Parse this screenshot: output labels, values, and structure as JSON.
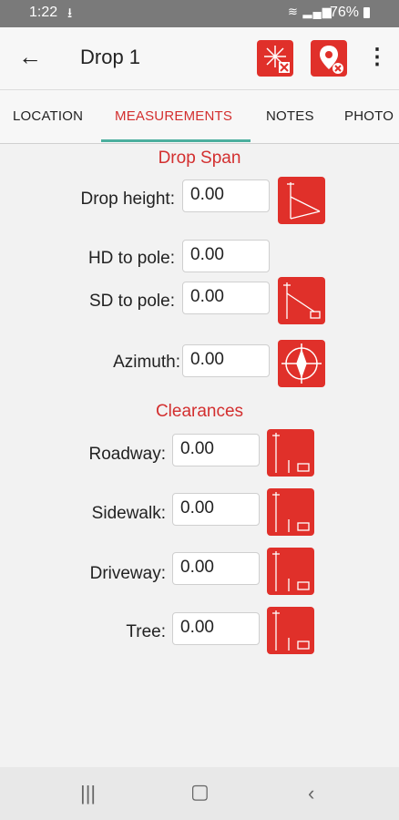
{
  "status": {
    "time": "1:22",
    "download_icon": "download-icon",
    "signal_icon": "wifi-signal-icon",
    "battery": "76%"
  },
  "appbar": {
    "title": "Drop 1",
    "back_icon": "arrow-left-icon",
    "action1_icon": "clear-measurement-icon",
    "action2_icon": "remove-location-icon",
    "more_icon": "more-vertical-icon"
  },
  "tabs": [
    {
      "label": "LOCATION"
    },
    {
      "label": "MEASUREMENTS"
    },
    {
      "label": "NOTES"
    },
    {
      "label": "PHOTO"
    }
  ],
  "active_tab": "MEASUREMENTS",
  "drop_span": {
    "title": "Drop Span",
    "drop_height": {
      "label": "Drop height:",
      "value": "0.00"
    },
    "hd_to_pole": {
      "label": "HD to pole:",
      "value": "0.00"
    },
    "sd_to_pole": {
      "label": "SD to pole:",
      "value": "0.00"
    },
    "azimuth": {
      "label": "Azimuth:",
      "value": "0.00"
    }
  },
  "clearances": {
    "title": "Clearances",
    "roadway": {
      "label": "Roadway:",
      "value": "0.00"
    },
    "sidewalk": {
      "label": "Sidewalk:",
      "value": "0.00"
    },
    "driveway": {
      "label": "Driveway:",
      "value": "0.00"
    },
    "tree": {
      "label": "Tree:",
      "value": "0.00"
    }
  },
  "colors": {
    "accent": "#e0302a",
    "accent_text": "#d32f2f",
    "tab_indicator": "#4caf9e"
  },
  "navbar": {
    "recents": "recents-icon",
    "home": "home-icon",
    "back": "back-icon"
  }
}
